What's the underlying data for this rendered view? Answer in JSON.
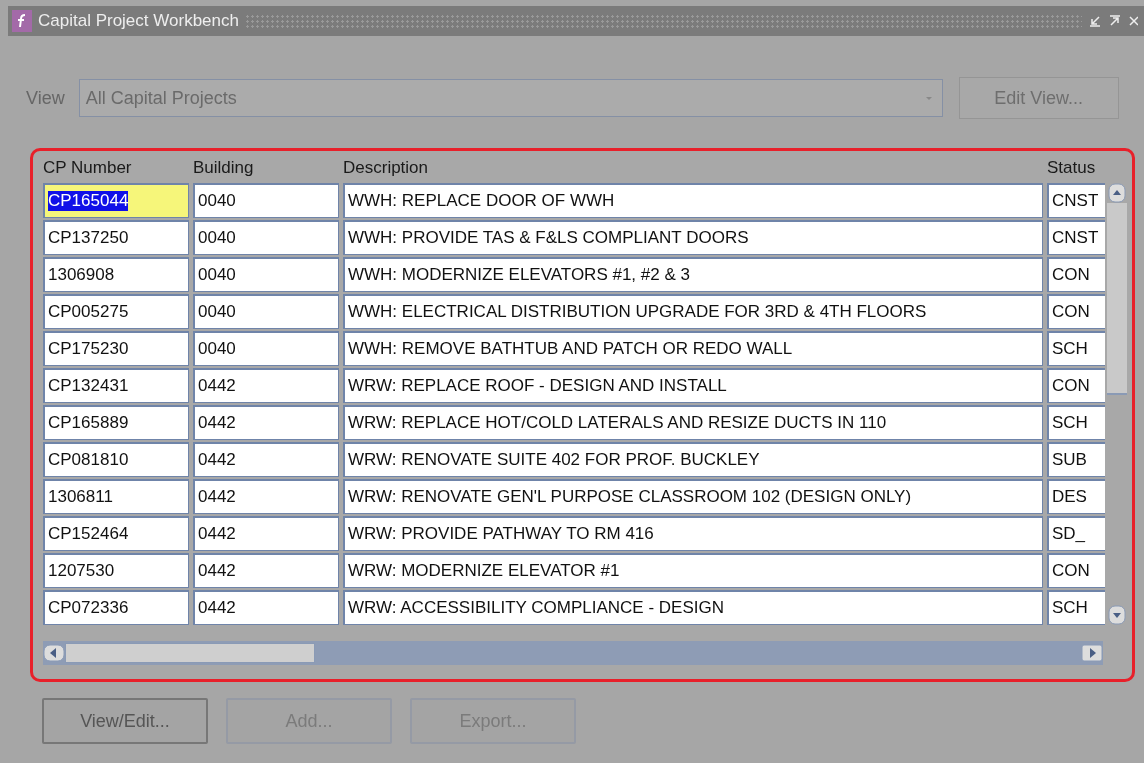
{
  "window": {
    "title": "Capital Project Workbench"
  },
  "view": {
    "label": "View",
    "value": "All Capital Projects",
    "button": "Edit View..."
  },
  "table": {
    "columns": [
      "CP Number",
      "Building",
      "Description",
      "Status"
    ],
    "rows": [
      {
        "cells": [
          "CP165044",
          "0040",
          "WWH: REPLACE DOOR OF WWH",
          "CNST"
        ],
        "selected": true
      },
      {
        "cells": [
          "CP137250",
          "0040",
          "WWH: PROVIDE TAS & F&LS COMPLIANT DOORS",
          "CNST"
        ],
        "selected": false
      },
      {
        "cells": [
          "1306908",
          "0040",
          "WWH: MODERNIZE ELEVATORS #1, #2 & 3",
          "CON"
        ],
        "selected": false
      },
      {
        "cells": [
          "CP005275",
          "0040",
          "WWH: ELECTRICAL DISTRIBUTION UPGRADE FOR 3RD & 4TH FLOORS",
          "CON"
        ],
        "selected": false
      },
      {
        "cells": [
          "CP175230",
          "0040",
          "WWH:  REMOVE BATHTUB AND PATCH OR REDO WALL",
          "SCH"
        ],
        "selected": false
      },
      {
        "cells": [
          "CP132431",
          "0442",
          "WRW: REPLACE ROOF - DESIGN AND INSTALL",
          "CON"
        ],
        "selected": false
      },
      {
        "cells": [
          "CP165889",
          "0442",
          "WRW: REPLACE HOT/COLD LATERALS AND RESIZE DUCTS IN 110",
          "SCH"
        ],
        "selected": false
      },
      {
        "cells": [
          "CP081810",
          "0442",
          "WRW: RENOVATE SUITE 402 FOR PROF. BUCKLEY",
          "SUB"
        ],
        "selected": false
      },
      {
        "cells": [
          "1306811",
          "0442",
          "WRW: RENOVATE GEN'L PURPOSE CLASSROOM 102 (DESIGN ONLY)",
          "DES"
        ],
        "selected": false
      },
      {
        "cells": [
          "CP152464",
          "0442",
          "WRW: PROVIDE PATHWAY TO RM 416",
          "SD_"
        ],
        "selected": false
      },
      {
        "cells": [
          "1207530",
          "0442",
          "WRW: MODERNIZE ELEVATOR #1",
          "CON"
        ],
        "selected": false
      },
      {
        "cells": [
          "CP072336",
          "0442",
          "WRW: ACCESSIBILITY COMPLIANCE - DESIGN",
          "SCH"
        ],
        "selected": false
      }
    ]
  },
  "buttons": [
    {
      "label": "View/Edit...",
      "disabled": false
    },
    {
      "label": "Add...",
      "disabled": true
    },
    {
      "label": "Export...",
      "disabled": true
    }
  ]
}
